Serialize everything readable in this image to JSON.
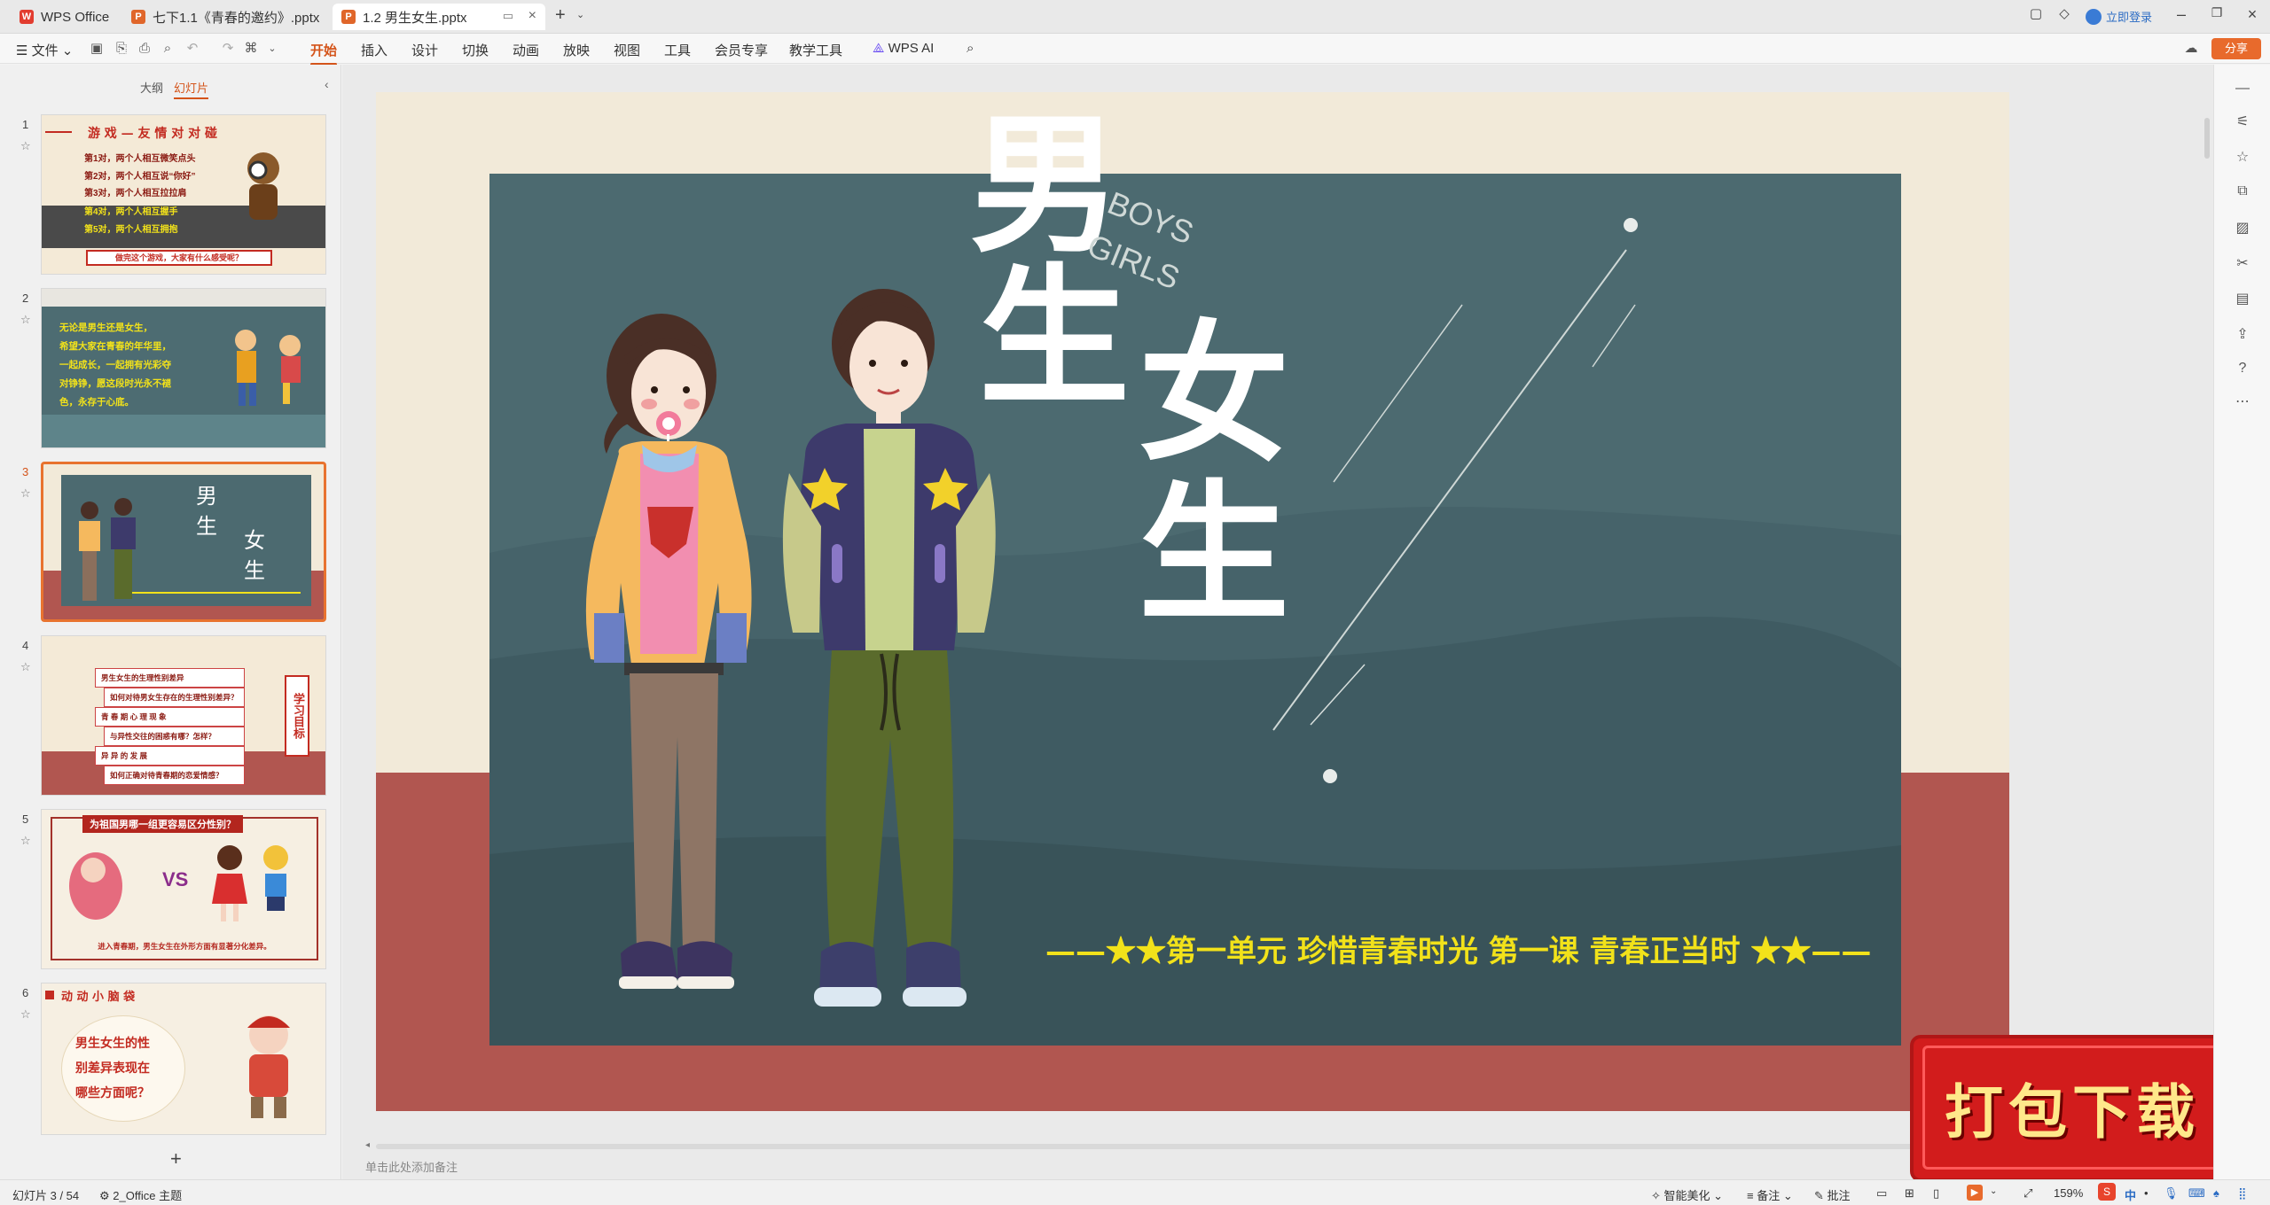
{
  "window": {
    "tabs": [
      {
        "label": "WPS Office"
      },
      {
        "label": "七下1.1《青春的邀约》.pptx"
      },
      {
        "label": "1.2 男生女生.pptx"
      }
    ],
    "login_label": "立即登录"
  },
  "menubar": {
    "file_label": "文件",
    "items": [
      "开始",
      "插入",
      "设计",
      "切换",
      "动画",
      "放映",
      "视图",
      "工具",
      "会员专享",
      "教学工具"
    ],
    "ai_label": "WPS AI",
    "share_label": "分享"
  },
  "panel": {
    "tab_outline": "大纲",
    "tab_slides": "幻灯片",
    "add_label": "+"
  },
  "thumbnails": [
    {
      "num": "1",
      "title": "游 戏 — 友 情 对 对 碰",
      "lines": [
        "第1对，两个人相互微笑点头",
        "第2对，两个人相互说“你好”",
        "第3对，两个人相互拉拉肩",
        "第4对，两个人相互握手",
        "第5对，两个人相互拥抱"
      ],
      "footer": "做完这个游戏，大家有什么感受呢？"
    },
    {
      "num": "2",
      "lines": [
        "无论是男生还是女生，",
        "希望大家在青春的年华里，",
        "一起成长，一起拥有光彩夺",
        "对铮铮，愿这段时光永不褪",
        "色，永存于心底。"
      ]
    },
    {
      "num": "3",
      "title1": "男",
      "title2": "生",
      "title3": "女",
      "title4": "生"
    },
    {
      "num": "4",
      "items": [
        "男生女生的生理性别差异",
        "如何对待男女生存在的生理性别差异？",
        "青 春 期 心 理 现 象",
        "与异性交往的困惑有哪？怎样？",
        "异 异 的 发 展",
        "如何正确对待青春期的恋爱情感？"
      ],
      "badge": "学习目标"
    },
    {
      "num": "5",
      "header": "为祖国男哪一组更容易区分性别？",
      "vs": "VS",
      "footer": "进入青春期，男生女生在外形方面有显著分化差异。"
    },
    {
      "num": "6",
      "header": "动 动 小 脑 袋",
      "question": [
        "男生女生的性",
        "别差异表现在",
        "哪些方面呢？"
      ]
    }
  ],
  "slide": {
    "title_boy1": "男",
    "title_boy2": "生",
    "title_girl1": "女",
    "title_girl2": "生",
    "en_boys": "BOYS",
    "en_girls": "GIRLS",
    "subtitle": "——★★第一单元 珍惜青春时光 第一课 青春正当时 ★★——"
  },
  "overlay": {
    "download_label": "打包下载"
  },
  "notes": {
    "placeholder": "单击此处添加备注"
  },
  "status": {
    "slide_count": "幻灯片 3 / 54",
    "theme": "2_Office 主题",
    "beautify": "智能美化",
    "notes_label": "备注",
    "comment_label": "批注",
    "zoom": "159%",
    "ime": "中"
  },
  "colors": {
    "accent": "#d4541a",
    "slide_teal": "#4c6a70",
    "slide_red": "#b15650",
    "slide_cream": "#f2ead9",
    "subtitle_yellow": "#f2e21a"
  }
}
